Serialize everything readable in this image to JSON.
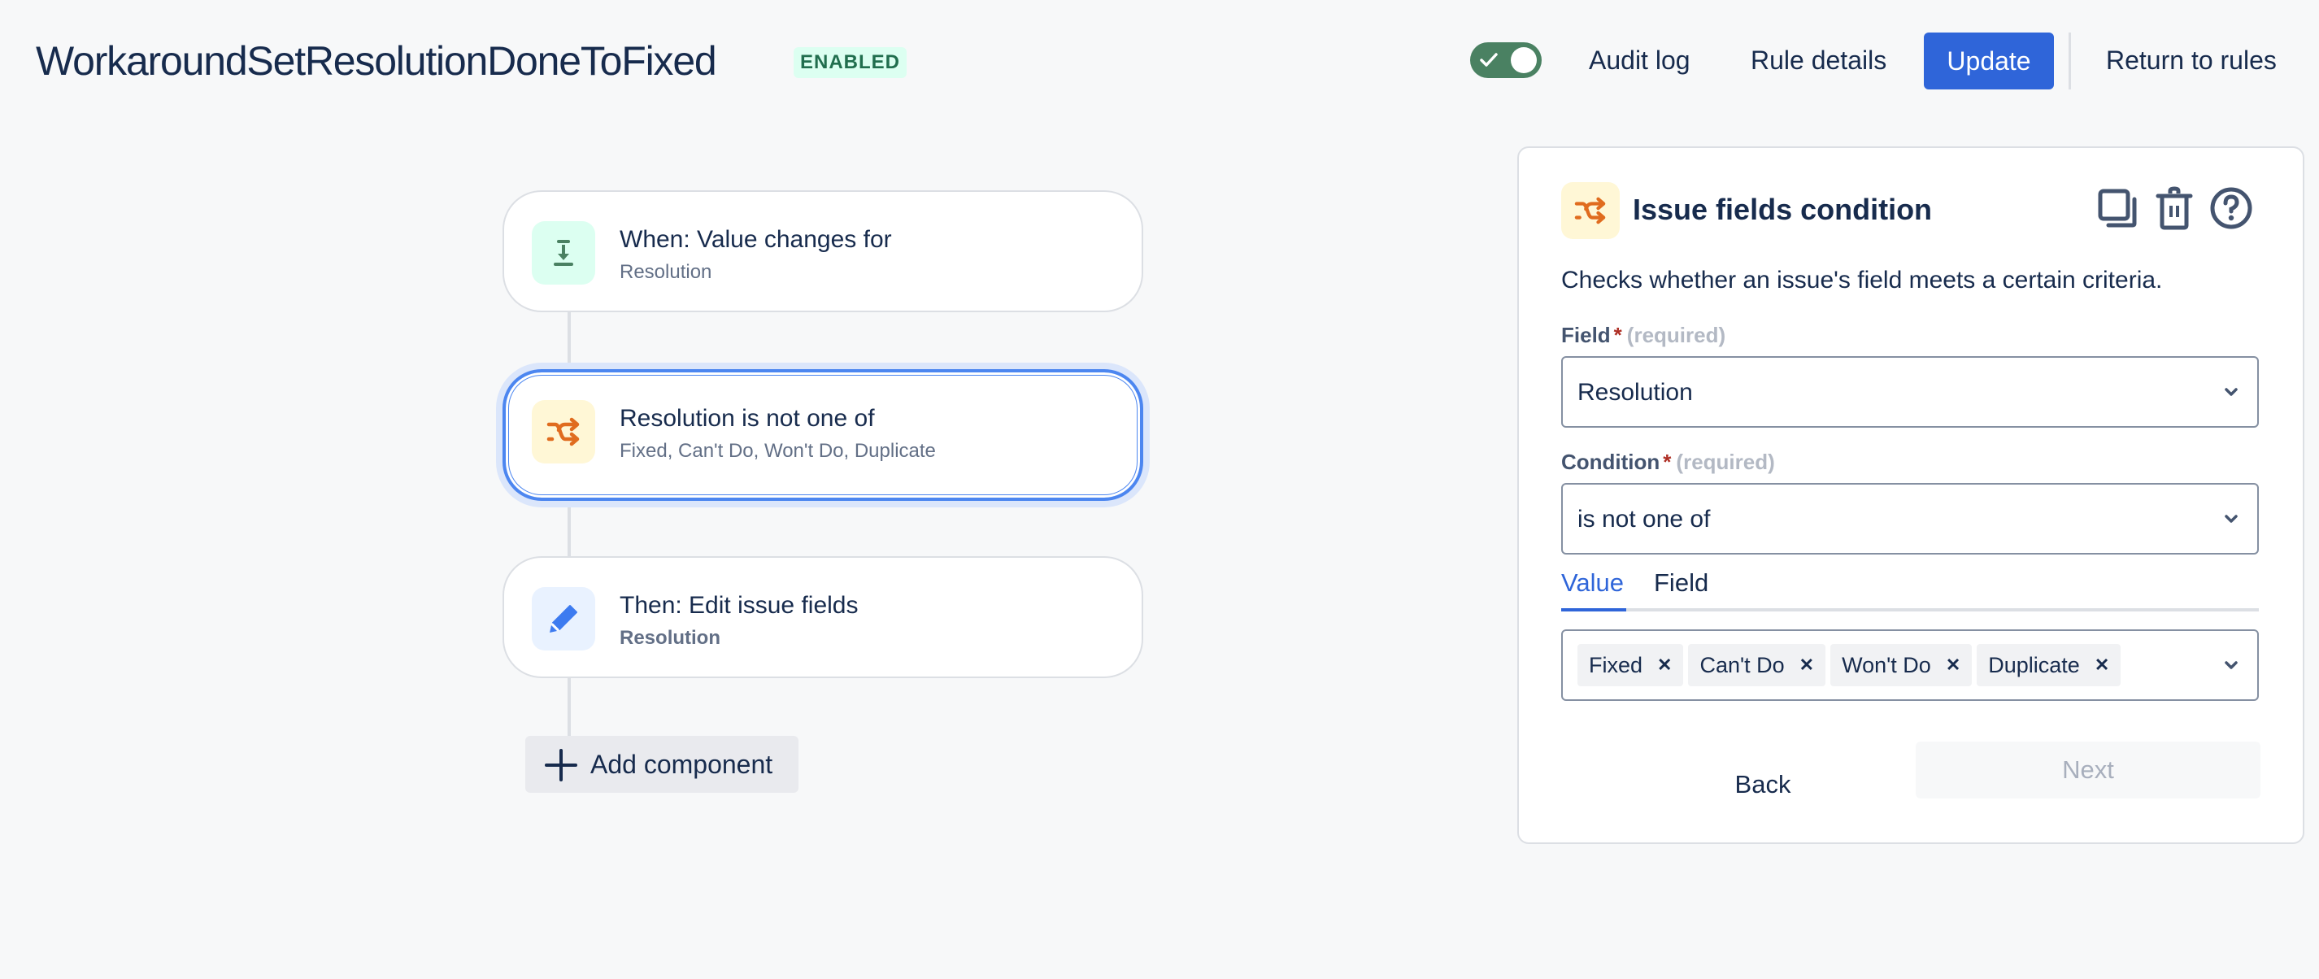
{
  "header": {
    "rule_name": "WorkaroundSetResolutionDoneToFixed",
    "status_badge": "ENABLED",
    "toggle_enabled": true,
    "audit_log": "Audit log",
    "rule_details": "Rule details",
    "update": "Update",
    "return_to_rules": "Return to rules"
  },
  "flow": {
    "nodes": [
      {
        "icon": "download-arrow-icon",
        "title": "When: Value changes for",
        "subtitle": "Resolution",
        "selected": false
      },
      {
        "icon": "shuffle-icon",
        "title": "Resolution is not one of",
        "subtitle": "Fixed, Can't Do, Won't Do, Duplicate",
        "selected": true
      },
      {
        "icon": "pencil-icon",
        "title": "Then: Edit issue fields",
        "subtitle": "Resolution",
        "selected": false
      }
    ],
    "add_component": "Add component"
  },
  "panel": {
    "title": "Issue fields condition",
    "description": "Checks whether an issue's field meets a certain criteria.",
    "field": {
      "label": "Field",
      "required_marker": "*",
      "required_hint": "(required)",
      "value": "Resolution"
    },
    "condition": {
      "label": "Condition",
      "required_marker": "*",
      "required_hint": "(required)",
      "value": "is not one of"
    },
    "tabs": [
      {
        "label": "Value",
        "active": true
      },
      {
        "label": "Field",
        "active": false
      }
    ],
    "values": [
      "Fixed",
      "Can't Do",
      "Won't Do",
      "Duplicate"
    ],
    "back": "Back",
    "next": "Next"
  },
  "colors": {
    "accent": "#2f65d9",
    "toggle_on": "#4a8162",
    "badge_bg": "#dcfff1",
    "badge_text": "#216e4e",
    "selected_border": "#4c86f0"
  }
}
